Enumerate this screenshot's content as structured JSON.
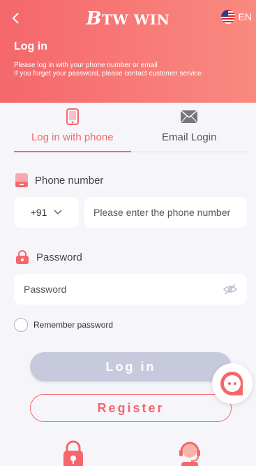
{
  "header": {
    "logo_b": "B",
    "logo_rest": "TW WIN",
    "language": "EN",
    "title": "Log in",
    "desc_line1": "Please log in with your phone number or email",
    "desc_line2": "If you forget your password, please contact customer service"
  },
  "tabs": [
    {
      "label": "Log in with phone",
      "active": true
    },
    {
      "label": "Email Login",
      "active": false
    }
  ],
  "phone": {
    "label": "Phone number",
    "country_code": "+91",
    "placeholder": "Please enter the phone number"
  },
  "password": {
    "label": "Password",
    "placeholder": "Password"
  },
  "remember_label": "Remember password",
  "buttons": {
    "login": "Log in",
    "register": "Register"
  },
  "colors": {
    "accent": "#f5676b",
    "header_gradient_end": "#f98a80",
    "login_disabled": "#c7c9dd",
    "background": "#f6f5fa"
  },
  "icons": [
    "back-icon",
    "us-flag-icon",
    "phone-icon",
    "mail-icon",
    "phone-number-icon",
    "lock-icon",
    "chevron-down-icon",
    "eye-off-icon",
    "chat-support-icon",
    "security-lock-icon",
    "customer-service-icon"
  ]
}
